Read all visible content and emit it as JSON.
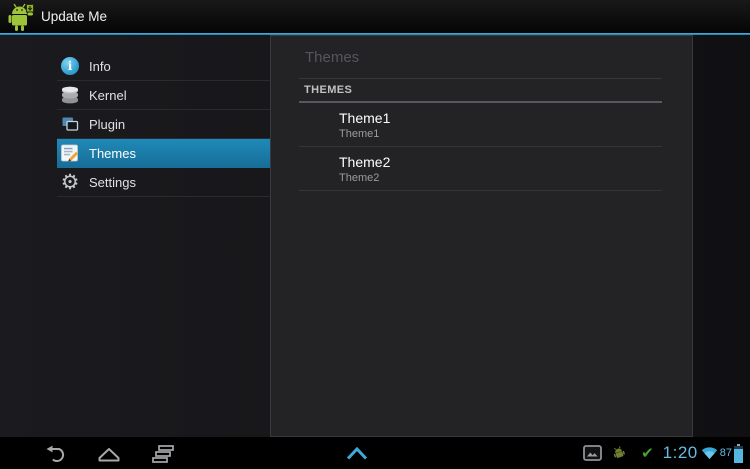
{
  "action_bar": {
    "title": "Update Me"
  },
  "sidebar": {
    "items": [
      {
        "label": "Info",
        "icon": "info-icon",
        "selected": false
      },
      {
        "label": "Kernel",
        "icon": "kernel-icon",
        "selected": false
      },
      {
        "label": "Plugin",
        "icon": "plugin-icon",
        "selected": false
      },
      {
        "label": "Themes",
        "icon": "themes-icon",
        "selected": true
      },
      {
        "label": "Settings",
        "icon": "settings-icon",
        "selected": false
      }
    ]
  },
  "panel": {
    "header": "Themes",
    "section_header": "THEMES",
    "items": [
      {
        "title": "Theme1",
        "subtitle": "Theme1"
      },
      {
        "title": "Theme2",
        "subtitle": "Theme2"
      }
    ]
  },
  "status_tray": {
    "clock": "1:20",
    "battery_percent": "87",
    "notification_icons": [
      "gallery-screenshot",
      "adb-debugging",
      "update-check-success"
    ],
    "signal_icons": [
      "wifi",
      "battery"
    ]
  },
  "icons": {
    "info_glyph": "i",
    "gear_glyph": "⚙",
    "check_glyph": "✔"
  },
  "colors": {
    "accent": "#33b5e5",
    "selected_item_bg": "#1b80af",
    "panel_bg": "#232326",
    "clock_blue": "#66bbe3",
    "check_green": "#4aa12e",
    "robot_green": "#a4c639"
  }
}
